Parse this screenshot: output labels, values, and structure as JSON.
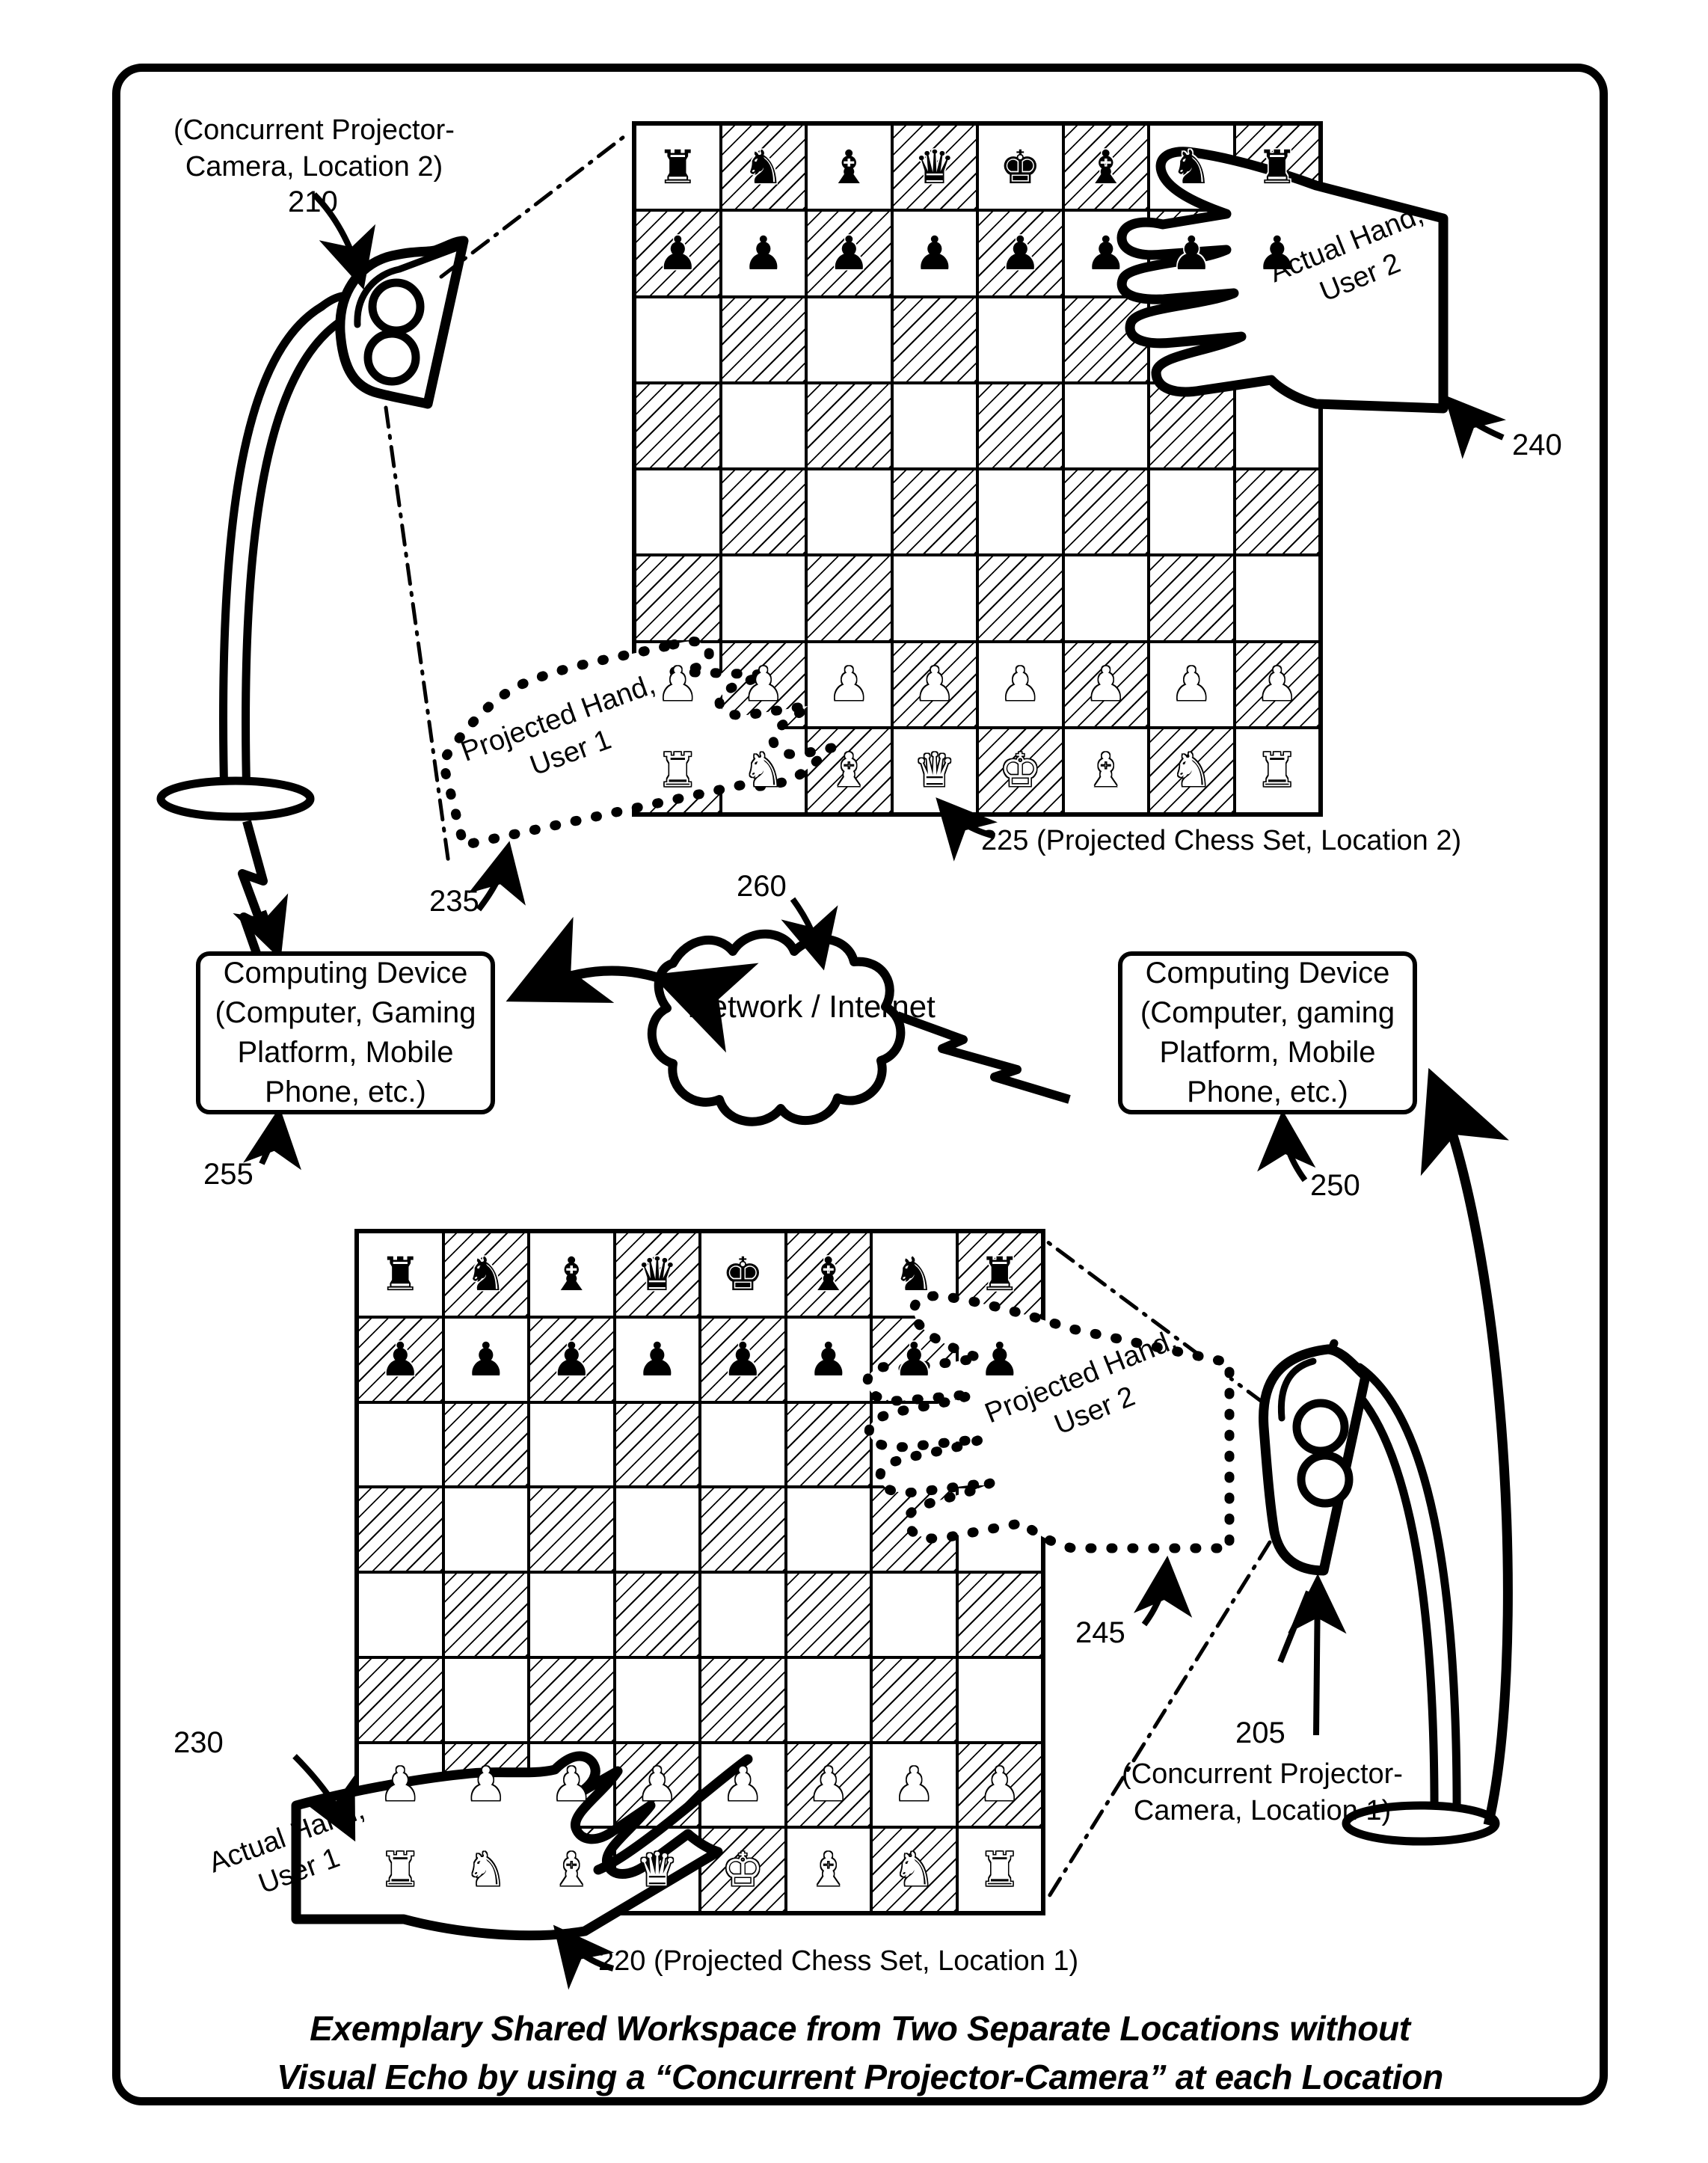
{
  "figure": {
    "caption_line1": "Exemplary Shared Workspace from Two Separate Locations without",
    "caption_line2": "Visual Echo by using a “Concurrent Projector-Camera” at each Location"
  },
  "labels": {
    "projector2_title": "(Concurrent Projector-\nCamera, Location 2)",
    "projector2_ref": "210",
    "projector1_ref": "205",
    "projector1_title": "(Concurrent Projector-\nCamera, Location 1)",
    "actual_hand_user2": "Actual Hand,\nUser 2",
    "actual_hand_user2_ref": "240",
    "actual_hand_user1": "Actual Hand,\nUser 1",
    "actual_hand_user1_ref": "230",
    "projected_hand_user1": "Projected Hand,\nUser 1",
    "projected_hand_user1_ref": "235",
    "projected_hand_user2": "Projected Hand,\nUser 2",
    "projected_hand_user2_ref": "245",
    "projected_chess_set_2": "225 (Projected Chess Set, Location 2)",
    "projected_chess_set_1": "220 (Projected Chess Set, Location 1)",
    "network_ref": "260",
    "network_label": "Network / Internet",
    "device_left_ref": "255",
    "device_right_ref": "250",
    "device_left_text": "Computing Device (Computer, Gaming Platform, Mobile Phone, etc.)",
    "device_right_text": "Computing Device (Computer, gaming Platform, Mobile Phone, etc.)"
  },
  "colors": {
    "ink": "#000000",
    "paper": "#ffffff"
  },
  "chess": {
    "board_top_name": "Projected Chess Set, Location 2",
    "board_bottom_name": "Projected Chess Set, Location 1",
    "rank_black_back": [
      "♜",
      "♞",
      "♝",
      "♛",
      "♚",
      "♝",
      "♞",
      "♜"
    ],
    "rank_black_pawns": [
      "♟",
      "♟",
      "♟",
      "♟",
      "♟",
      "♟",
      "♟",
      "♟"
    ],
    "rank_white_pawns": [
      "♟",
      "♟",
      "♟",
      "♟",
      "♟",
      "♟",
      "♟",
      "♟"
    ],
    "rank_white_back": [
      "♜",
      "♞",
      "♝",
      "♛",
      "♚",
      "♝",
      "♞",
      "♜"
    ]
  }
}
